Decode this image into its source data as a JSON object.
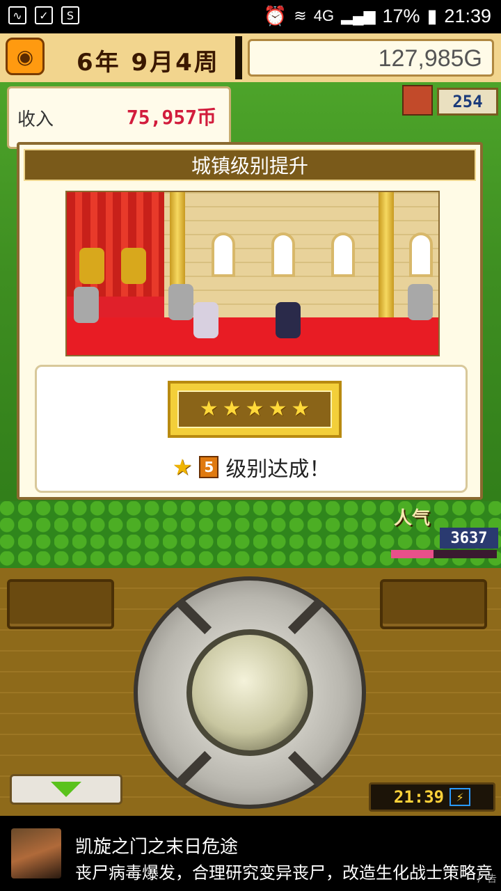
{
  "status_bar": {
    "icons_left": [
      "activity-icon",
      "checklist-icon",
      "s-app-icon"
    ],
    "network": "4G",
    "battery": "17%",
    "time": "21:39"
  },
  "top_bar": {
    "date": "6年 9月4周",
    "gold": "127,985G"
  },
  "hud": {
    "income_label": "收入",
    "income_value": "75,957币",
    "population": "254",
    "popularity_label": "人气",
    "popularity_value": "3637",
    "popularity_fill": 0.4
  },
  "dialog": {
    "title": "城镇级别提升",
    "stars": 5,
    "level": "5",
    "result_text": "级别达成！"
  },
  "controller": {
    "clock": "21:39"
  },
  "ad": {
    "title": "凯旋之门之末日危途",
    "description": "丧尸病毒爆发，合理研究变异丧尸，改造生化战士策略竞技！",
    "tag": "广告"
  }
}
